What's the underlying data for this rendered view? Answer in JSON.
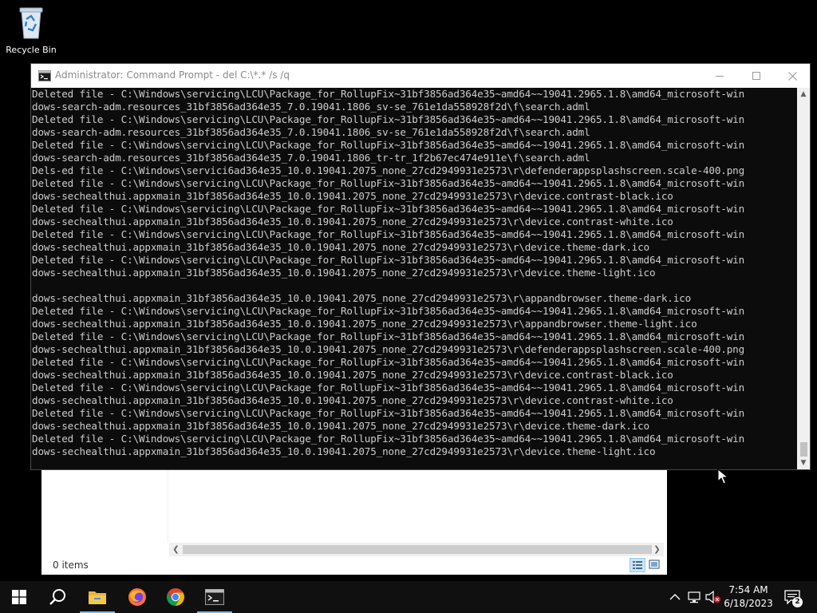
{
  "desktop": {
    "recycle_bin_label": "Recycle Bin"
  },
  "explorer": {
    "status_text": "0 items"
  },
  "cmd": {
    "title": "Administrator:  Command Prompt - del  C:\\*.* /s /q",
    "lines": [
      "Deleted file - C:\\Windows\\servicing\\LCU\\Package_for_RollupFix~31bf3856ad364e35~amd64~~19041.2965.1.8\\amd64_microsoft-win",
      "dows-search-adm.resources_31bf3856ad364e35_7.0.19041.1806_sv-se_761e1da558928f2d\\f\\search.adml",
      "Deleted file - C:\\Windows\\servicing\\LCU\\Package_for_RollupFix~31bf3856ad364e35~amd64~~19041.2965.1.8\\amd64_microsoft-win",
      "dows-search-adm.resources_31bf3856ad364e35_7.0.19041.1806_sv-se_761e1da558928f2d\\f\\search.adml",
      "Deleted file - C:\\Windows\\servicing\\LCU\\Package_for_RollupFix~31bf3856ad364e35~amd64~~19041.2965.1.8\\amd64_microsoft-win",
      "dows-search-adm.resources_31bf3856ad364e35_7.0.19041.1806_tr-tr_1f2b67ec474e911e\\f\\search.adml",
      "Dels-ed file - C:\\Windows\\servici6ad364e35_10.0.19041.2075_none_27cd2949931e2573\\r\\defenderappsplashscreen.scale-400.png",
      "Deleted file - C:\\Windows\\servicing\\LCU\\Package_for_RollupFix~31bf3856ad364e35~amd64~~19041.2965.1.8\\amd64_microsoft-win",
      "dows-sechealthui.appxmain_31bf3856ad364e35_10.0.19041.2075_none_27cd2949931e2573\\r\\device.contrast-black.ico",
      "Deleted file - C:\\Windows\\servicing\\LCU\\Package_for_RollupFix~31bf3856ad364e35~amd64~~19041.2965.1.8\\amd64_microsoft-win",
      "dows-sechealthui.appxmain_31bf3856ad364e35_10.0.19041.2075_none_27cd2949931e2573\\r\\device.contrast-white.ico",
      "Deleted file - C:\\Windows\\servicing\\LCU\\Package_for_RollupFix~31bf3856ad364e35~amd64~~19041.2965.1.8\\amd64_microsoft-win",
      "dows-sechealthui.appxmain_31bf3856ad364e35_10.0.19041.2075_none_27cd2949931e2573\\r\\device.theme-dark.ico",
      "Deleted file - C:\\Windows\\servicing\\LCU\\Package_for_RollupFix~31bf3856ad364e35~amd64~~19041.2965.1.8\\amd64_microsoft-win",
      "dows-sechealthui.appxmain_31bf3856ad364e35_10.0.19041.2075_none_27cd2949931e2573\\r\\device.theme-light.ico",
      "",
      "dows-sechealthui.appxmain_31bf3856ad364e35_10.0.19041.2075_none_27cd2949931e2573\\r\\appandbrowser.theme-dark.ico",
      "Deleted file - C:\\Windows\\servicing\\LCU\\Package_for_RollupFix~31bf3856ad364e35~amd64~~19041.2965.1.8\\amd64_microsoft-win",
      "dows-sechealthui.appxmain_31bf3856ad364e35_10.0.19041.2075_none_27cd2949931e2573\\r\\appandbrowser.theme-light.ico",
      "Deleted file - C:\\Windows\\servicing\\LCU\\Package_for_RollupFix~31bf3856ad364e35~amd64~~19041.2965.1.8\\amd64_microsoft-win",
      "dows-sechealthui.appxmain_31bf3856ad364e35_10.0.19041.2075_none_27cd2949931e2573\\r\\defenderappsplashscreen.scale-400.png",
      "Deleted file - C:\\Windows\\servicing\\LCU\\Package_for_RollupFix~31bf3856ad364e35~amd64~~19041.2965.1.8\\amd64_microsoft-win",
      "dows-sechealthui.appxmain_31bf3856ad364e35_10.0.19041.2075_none_27cd2949931e2573\\r\\device.contrast-black.ico",
      "Deleted file - C:\\Windows\\servicing\\LCU\\Package_for_RollupFix~31bf3856ad364e35~amd64~~19041.2965.1.8\\amd64_microsoft-win",
      "dows-sechealthui.appxmain_31bf3856ad364e35_10.0.19041.2075_none_27cd2949931e2573\\r\\device.contrast-white.ico",
      "Deleted file - C:\\Windows\\servicing\\LCU\\Package_for_RollupFix~31bf3856ad364e35~amd64~~19041.2965.1.8\\amd64_microsoft-win",
      "dows-sechealthui.appxmain_31bf3856ad364e35_10.0.19041.2075_none_27cd2949931e2573\\r\\device.theme-dark.ico",
      "Deleted file - C:\\Windows\\servicing\\LCU\\Package_for_RollupFix~31bf3856ad364e35~amd64~~19041.2965.1.8\\amd64_microsoft-win",
      "dows-sechealthui.appxmain_31bf3856ad364e35_10.0.19041.2075_none_27cd2949931e2573\\r\\device.theme-light.ico"
    ]
  },
  "taskbar": {
    "apps": [
      {
        "icon": "start-windows-icon"
      },
      {
        "icon": "search-icon"
      },
      {
        "icon": "file-explorer-icon"
      },
      {
        "icon": "firefox-icon"
      },
      {
        "icon": "chrome-icon"
      },
      {
        "icon": "command-prompt-icon"
      }
    ],
    "clock_time": "7:54 AM",
    "clock_date": "6/18/2023",
    "notification_count": "2"
  },
  "colors": {
    "console_bg": "#0c0c0c",
    "console_text": "#cccccc",
    "taskbar_bg": "#101010",
    "active_indicator": "#76b9ed"
  }
}
